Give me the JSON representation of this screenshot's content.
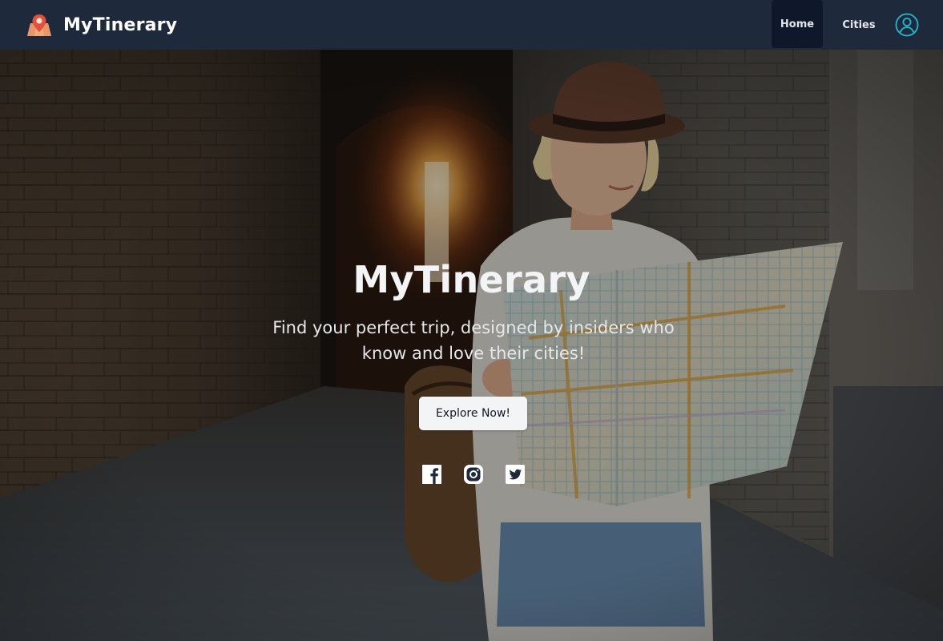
{
  "navbar": {
    "brand_name": "MyTinerary",
    "links": [
      {
        "label": "Home",
        "active": true
      },
      {
        "label": "Cities",
        "active": false
      }
    ],
    "user_icon": "user-circle-icon",
    "logo_icon": "map-pin-icon"
  },
  "hero": {
    "title": "MyTinerary",
    "subtitle": "Find your perfect trip, designed by insiders who know and love their cities!",
    "cta_label": "Explore Now!",
    "background": "traveler-with-map-photo",
    "socials": [
      "facebook-icon",
      "instagram-icon",
      "twitter-icon"
    ]
  },
  "colors": {
    "navbar_bg": "#1e293b",
    "nav_active_bg": "#0f172a",
    "user_icon": "#22b8cf",
    "button_bg": "#f3f4f6"
  }
}
